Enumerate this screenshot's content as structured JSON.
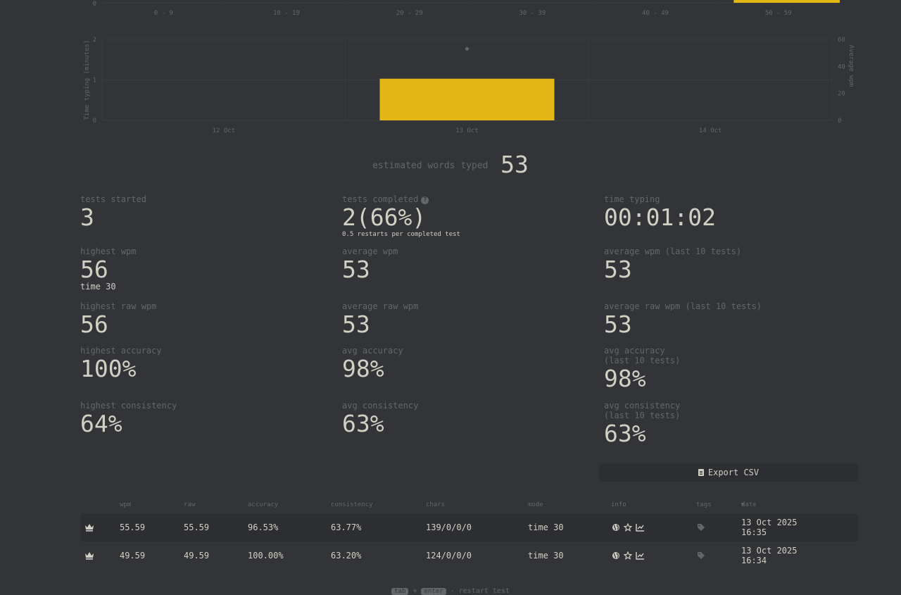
{
  "histogram": {
    "y_tick": "0",
    "x_ticks": [
      "0 - 9",
      "10 - 19",
      "20 - 29",
      "30 - 39",
      "40 - 49",
      "50 - 59"
    ],
    "bar_color": "#e2b714"
  },
  "daily_chart": {
    "left_label": "Time typing (minutes)",
    "right_label": "Average wpm",
    "left_ticks": [
      "2",
      "1",
      "0"
    ],
    "right_ticks": [
      "60",
      "40",
      "20",
      "0"
    ],
    "x_ticks": [
      "12 Oct",
      "13 Oct",
      "14 Oct"
    ],
    "bar_color": "#e2b714"
  },
  "chart_data": [
    {
      "type": "bar",
      "categories": [
        "0 - 9",
        "10 - 19",
        "20 - 29",
        "30 - 39",
        "40 - 49",
        "50 - 59"
      ],
      "values": [
        0,
        0,
        0,
        0,
        0,
        2
      ],
      "xlabel": "",
      "ylabel": ""
    },
    {
      "type": "bar",
      "categories": [
        "12 Oct",
        "13 Oct",
        "14 Oct"
      ],
      "series": [
        {
          "name": "Time typing (minutes)",
          "values": [
            0,
            1.03,
            0
          ]
        },
        {
          "name": "Average wpm",
          "type": "scatter",
          "values": [
            null,
            53,
            null
          ]
        }
      ],
      "ylabel": "Time typing (minutes)",
      "y2label": "Average wpm",
      "ylim": [
        0,
        2
      ],
      "y2lim": [
        0,
        60
      ]
    }
  ],
  "estimated": {
    "label": "estimated words typed",
    "value": "53"
  },
  "stats": {
    "tests_started": {
      "label": "tests started",
      "value": "3"
    },
    "tests_completed": {
      "label": "tests completed",
      "value": "2(66%)",
      "sub": "0.5 restarts per completed test"
    },
    "time_typing": {
      "label": "time typing",
      "value": "00:01:02"
    },
    "highest_wpm": {
      "label": "highest wpm",
      "value": "56",
      "sub": "time 30"
    },
    "average_wpm": {
      "label": "average wpm",
      "value": "53"
    },
    "average_wpm_last10": {
      "label": "average wpm (last 10 tests)",
      "value": "53"
    },
    "highest_raw": {
      "label": "highest raw wpm",
      "value": "56"
    },
    "average_raw": {
      "label": "average raw wpm",
      "value": "53"
    },
    "average_raw_last10": {
      "label": "average raw wpm (last 10 tests)",
      "value": "53"
    },
    "highest_acc": {
      "label": "highest accuracy",
      "value": "100%"
    },
    "avg_acc": {
      "label": "avg accuracy",
      "value": "98%"
    },
    "avg_acc_last10": {
      "label": "avg accuracy\n(last 10 tests)",
      "value": "98%"
    },
    "highest_cons": {
      "label": "highest consistency",
      "value": "64%"
    },
    "avg_cons": {
      "label": "avg consistency",
      "value": "63%"
    },
    "avg_cons_last10": {
      "label": "avg consistency\n(last 10 tests)",
      "value": "63%"
    }
  },
  "export": {
    "label": "Export CSV",
    "icon": "file-csv-icon"
  },
  "table": {
    "headers": {
      "wpm": "wpm",
      "raw": "raw",
      "accuracy": "accuracy",
      "consistency": "consistency",
      "chars": "chars",
      "mode": "mode",
      "info": "info",
      "tags": "tags",
      "date": "date"
    },
    "rows": [
      {
        "wpm": "55.59",
        "raw": "55.59",
        "accuracy": "96.53%",
        "consistency": "63.77%",
        "chars": "139/0/0/0",
        "mode": "time 30",
        "date": "13 Oct 2025",
        "time": "16:35"
      },
      {
        "wpm": "49.59",
        "raw": "49.59",
        "accuracy": "100.00%",
        "consistency": "63.20%",
        "chars": "124/0/0/0",
        "mode": "time 30",
        "date": "13 Oct 2025",
        "time": "16:34"
      }
    ]
  },
  "footer": {
    "key1": "tab",
    "plus": "+",
    "key2": "enter",
    "action": "- restart test"
  },
  "colors": {
    "bg": "#323437",
    "text": "#d1d0c5",
    "sub": "#646669",
    "accent": "#e2b714",
    "sub_alt": "#2c2e31"
  }
}
